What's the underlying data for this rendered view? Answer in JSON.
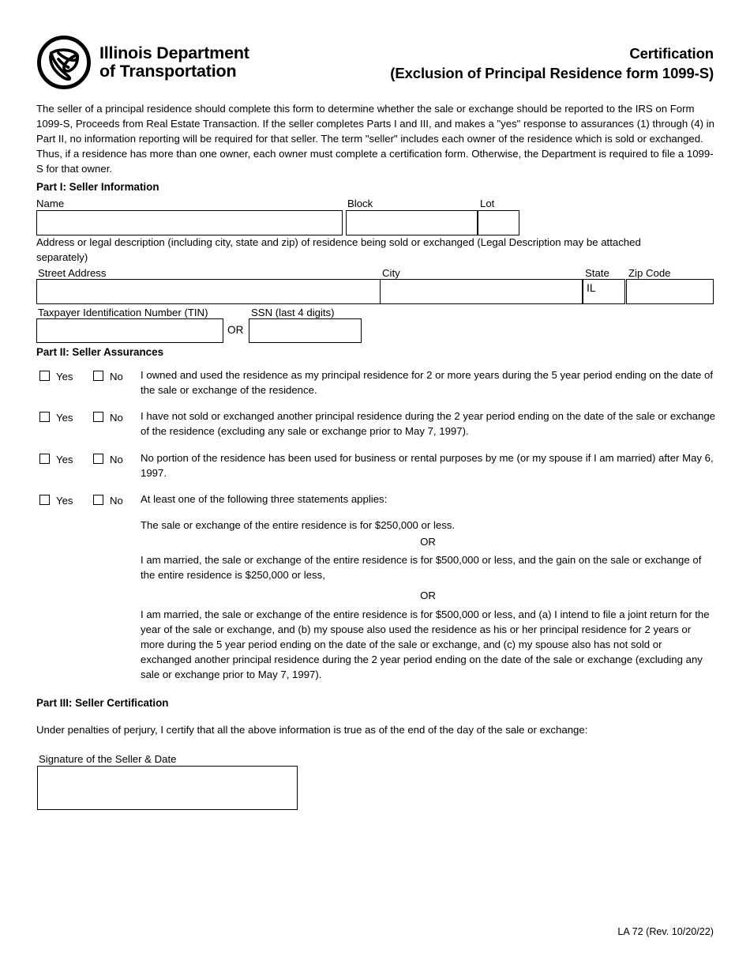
{
  "header": {
    "logo_line1": "Illinois Department",
    "logo_line2": "of Transportation",
    "title_main": "Certification",
    "title_sub": "(Exclusion of Principal Residence form 1099-S)"
  },
  "intro": "The seller of a principal residence should complete this form to determine whether the sale or exchange should be reported to the IRS on Form 1099-S, Proceeds from Real Estate Transaction.  If the seller completes Parts I and III, and makes a \"yes\" response to assurances (1) through (4) in Part II, no information reporting will be required for that seller.  The term \"seller\" includes each owner of the residence which is sold or exchanged.  Thus, if a residence has more than one owner, each owner must complete a certification form.  Otherwise, the Department is required to file a 1099-S for that owner.",
  "part1": {
    "heading": "Part I: Seller Information",
    "name_label": "Name",
    "name_value": "",
    "block_label": "Block",
    "block_value": "",
    "lot_label": "Lot",
    "lot_value": "",
    "address_note": "Address or legal description (including city, state and zip) of residence being sold or exchanged (Legal Description may be attached separately)",
    "street_label": "Street Address",
    "street_value": "",
    "city_label": "City",
    "city_value": "",
    "state_label": "State",
    "state_value": "IL",
    "zip_label": "Zip Code",
    "zip_value": "",
    "tin_label": "Taxpayer Identification Number (TIN)",
    "tin_value": "",
    "or_label": "OR",
    "ssn_label": "SSN (last 4 digits)",
    "ssn_value": ""
  },
  "part2": {
    "heading": "Part II: Seller Assurances",
    "yes_label": "Yes",
    "no_label": "No",
    "or_separator": "OR",
    "assurances": [
      {
        "text": "I owned and used the residence as my principal residence for 2 or more years during the 5 year period ending on the date of the sale or exchange of the residence."
      },
      {
        "text": "I have not sold or exchanged another principal residence during the 2 year period ending on the date of the sale or exchange of the residence (excluding any sale or exchange prior to May 7, 1997)."
      },
      {
        "text": "No portion of the residence has been used for business or rental purposes by me (or my spouse if I am married) after May 6, 1997."
      },
      {
        "text": "At least one of the following three statements applies:"
      }
    ],
    "statements": [
      "The sale or exchange of the entire residence is for $250,000 or less.",
      "I am married, the sale or exchange of the entire residence is for $500,000 or less, and the gain on the sale or exchange of the entire residence is $250,000 or less,",
      "I am married, the sale or exchange of the entire residence is for $500,000 or less, and (a) I intend to file a joint return for the year of the sale or exchange, and (b) my spouse also used the residence as his or her principal residence for 2 years or more during the 5 year period ending on the date of the sale or exchange, and (c) my spouse also has not sold or exchanged another principal residence during the 2 year period ending on the date of the sale or exchange (excluding any sale or exchange prior to May 7, 1997)."
    ]
  },
  "part3": {
    "heading": "Part III: Seller Certification",
    "perjury": "Under penalties of perjury, I certify that all the above information is true as of the end of the day of the sale or exchange:",
    "signature_label": "Signature of the Seller & Date",
    "signature_value": ""
  },
  "footer": {
    "revision": "LA 72 (Rev. 10/20/22)"
  }
}
